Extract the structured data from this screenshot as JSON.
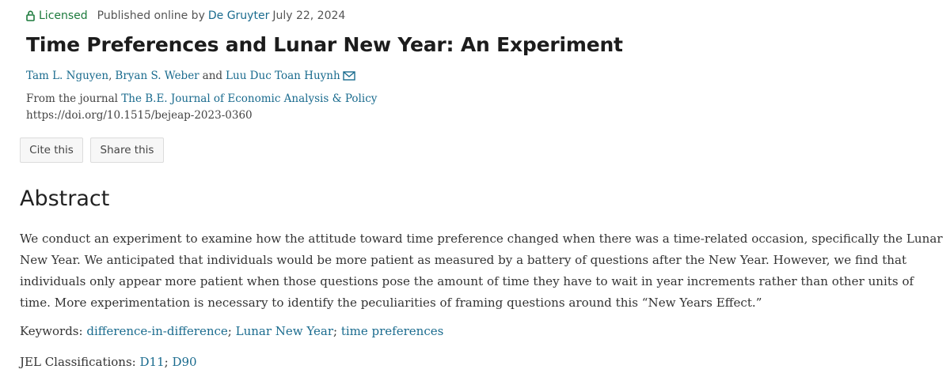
{
  "header": {
    "license_label": "Licensed",
    "published_prefix": "Published online by",
    "publisher": "De Gruyter",
    "date": "July 22, 2024"
  },
  "article": {
    "title": "Time Preferences and Lunar New Year: An Experiment",
    "authors": [
      "Tam L. Nguyen",
      "Bryan S. Weber",
      "Luu Duc Toan Huynh"
    ],
    "author_sep_1": ",",
    "author_sep_2": "and",
    "journal_prefix": "From the journal",
    "journal": "The B.E. Journal of Economic Analysis & Policy",
    "doi": "https://doi.org/10.1515/bejeap-2023-0360"
  },
  "actions": {
    "cite_label": "Cite this",
    "share_label": "Share this"
  },
  "abstract": {
    "heading": "Abstract",
    "text": "We conduct an experiment to examine how the attitude toward time preference changed when there was a time-related occasion, specifically the Lunar New Year. We anticipated that individuals would be more patient as measured by a battery of questions after the New Year. However, we find that individuals only appear more patient when those questions pose the amount of time they have to wait in year increments rather than other units of time. More experimentation is necessary to identify the peculiarities of framing questions around this “New Years Effect.”"
  },
  "keywords": {
    "label": "Keywords:",
    "items": [
      "difference-in-difference",
      "Lunar New Year",
      "time preferences"
    ],
    "separator": ";"
  },
  "jel": {
    "label": "JEL Classifications:",
    "items": [
      "D11",
      "D90"
    ],
    "separator": ";"
  },
  "colors": {
    "link": "#1a6b8e",
    "license": "#1c7a3c",
    "text": "#333333"
  },
  "icons": {
    "license": "lock-open-icon",
    "email": "envelope-icon"
  }
}
